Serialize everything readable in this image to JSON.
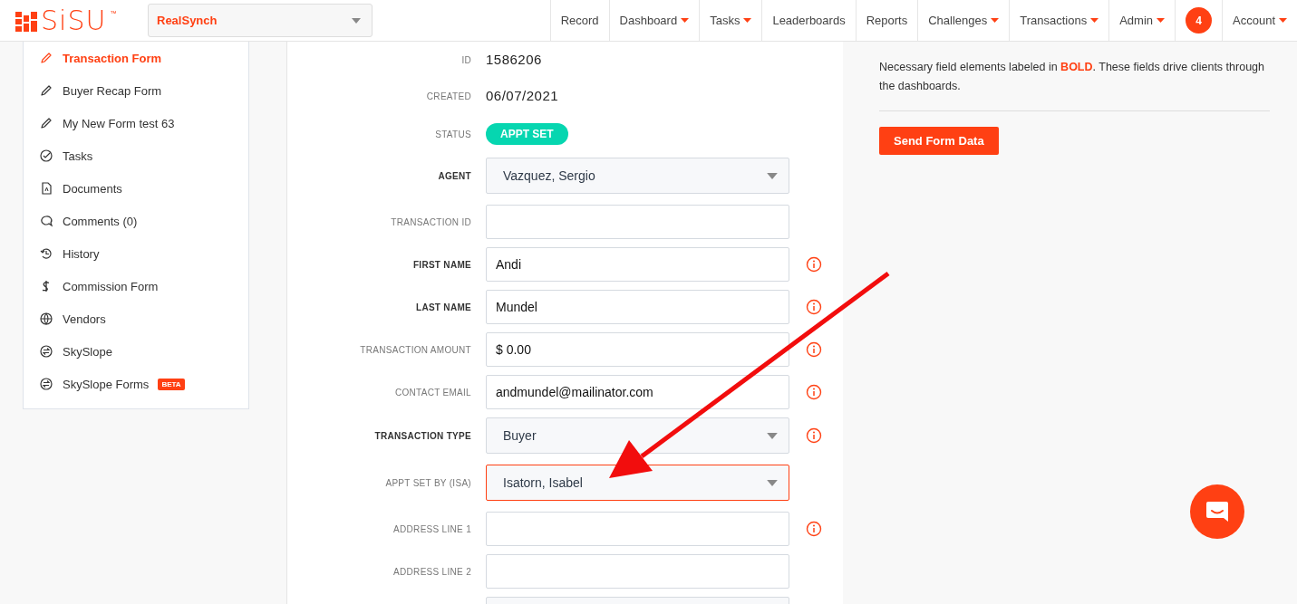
{
  "header": {
    "logo": {
      "text": "SiSU",
      "mark": "™"
    },
    "org_select": {
      "value": "RealSynch"
    },
    "nav": [
      {
        "label": "Record",
        "dropdown": false
      },
      {
        "label": "Dashboard",
        "dropdown": true
      },
      {
        "label": "Tasks",
        "dropdown": true
      },
      {
        "label": "Leaderboards",
        "dropdown": false
      },
      {
        "label": "Reports",
        "dropdown": false
      },
      {
        "label": "Challenges",
        "dropdown": true
      },
      {
        "label": "Transactions",
        "dropdown": true
      },
      {
        "label": "Admin",
        "dropdown": true
      },
      {
        "kind": "badge",
        "label": "4"
      },
      {
        "label": "Account",
        "dropdown": true
      }
    ]
  },
  "sidebar": {
    "items": [
      {
        "label": "Transaction Form",
        "selected": true
      },
      {
        "label": "Buyer Recap Form",
        "selected": false
      },
      {
        "label": "My New Form test 63",
        "selected": false
      },
      {
        "label": "Tasks",
        "selected": false
      },
      {
        "label": "Documents",
        "selected": false
      },
      {
        "label": "Comments (0)",
        "selected": false
      },
      {
        "label": "History",
        "selected": false
      },
      {
        "label": "Commission Form",
        "selected": false
      },
      {
        "label": "Vendors",
        "selected": false
      },
      {
        "label": "SkySlope",
        "selected": false
      },
      {
        "label": "SkySlope Forms",
        "selected": false,
        "badge": "BETA"
      }
    ]
  },
  "form": {
    "rows": [
      {
        "kind": "static",
        "label": "ID",
        "required": false,
        "value": "1586206",
        "info": false
      },
      {
        "kind": "static",
        "label": "CREATED",
        "required": false,
        "value": "06/07/2021",
        "info": false
      },
      {
        "kind": "status",
        "label": "STATUS",
        "required": false,
        "value": "APPT SET",
        "info": false
      },
      {
        "kind": "select",
        "label": "AGENT",
        "required": true,
        "value": "Vazquez, Sergio",
        "info": false,
        "highlighted": false
      },
      {
        "kind": "input",
        "label": "TRANSACTION ID",
        "required": false,
        "info": false
      },
      {
        "kind": "input",
        "label": "FIRST NAME",
        "required": true,
        "value": "Andi",
        "info": true
      },
      {
        "kind": "input",
        "label": "LAST NAME",
        "required": true,
        "value": "Mundel",
        "info": true
      },
      {
        "kind": "input",
        "label": "TRANSACTION AMOUNT",
        "required": false,
        "value": "$ 0.00",
        "info": true
      },
      {
        "kind": "input",
        "label": "CONTACT EMAIL",
        "required": false,
        "value": "andmundel@mailinator.com",
        "info": true
      },
      {
        "kind": "select",
        "label": "TRANSACTION TYPE",
        "required": true,
        "value": "Buyer",
        "info": true,
        "highlighted": false
      },
      {
        "kind": "select",
        "label": "APPT SET BY (ISA)",
        "required": false,
        "value": "Isatorn, Isabel",
        "info": false,
        "highlighted": true
      },
      {
        "kind": "input",
        "label": "ADDRESS LINE 1",
        "required": false,
        "info": true
      },
      {
        "kind": "input",
        "label": "ADDRESS LINE 2",
        "required": false,
        "info": false
      },
      {
        "kind": "select",
        "highlighted": false
      }
    ]
  },
  "side_panel": {
    "note": "Necessary field elements labeled in **BOLD**. These fields drive clients through the dashboards.",
    "button": "Send Form Data"
  }
}
